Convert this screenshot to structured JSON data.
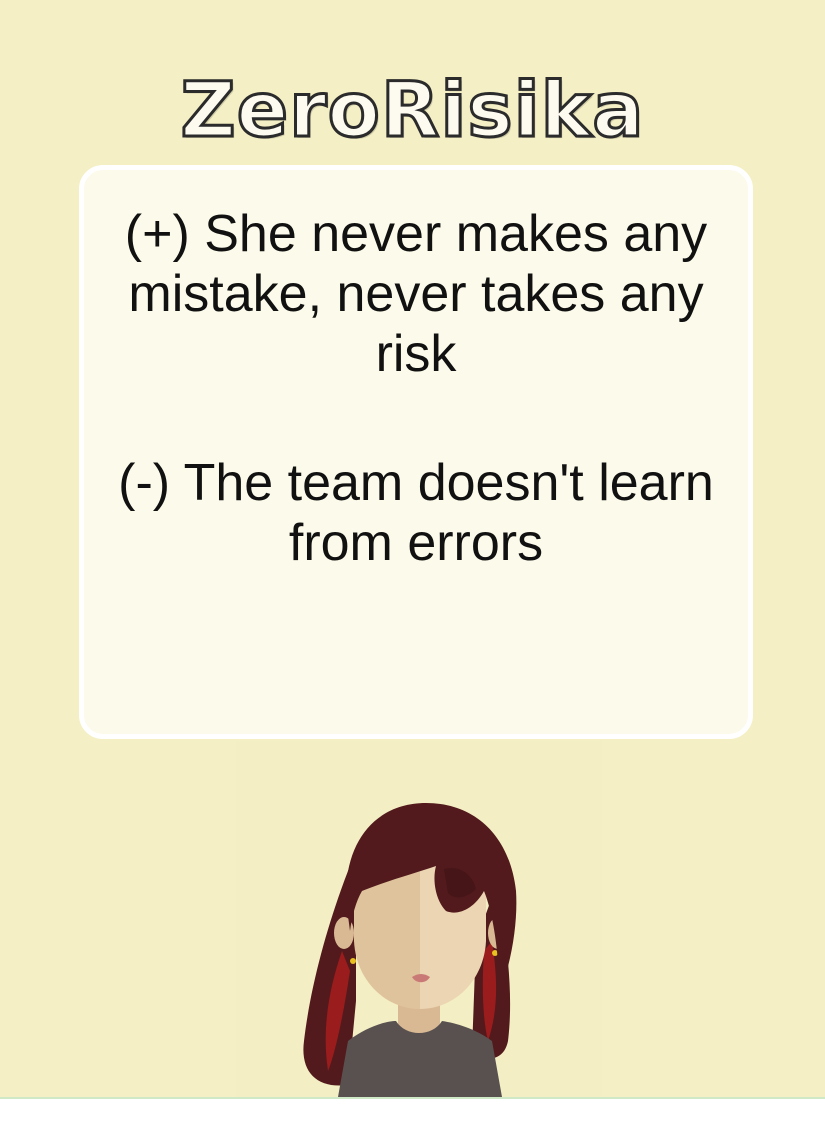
{
  "title": "ZeroRisika",
  "card": {
    "pro": "(+) She never makes any mistake, never takes any risk",
    "con": "(-) The team doesn't learn from errors"
  },
  "colors": {
    "background": "#f4efc4",
    "card": "#fcfaea",
    "hair": "#521a1c",
    "hair_highlight": "#9a1c1c",
    "skin": "#e5cba3",
    "shirt": "#595150"
  },
  "avatar": {
    "icon": "woman-avatar-icon"
  }
}
